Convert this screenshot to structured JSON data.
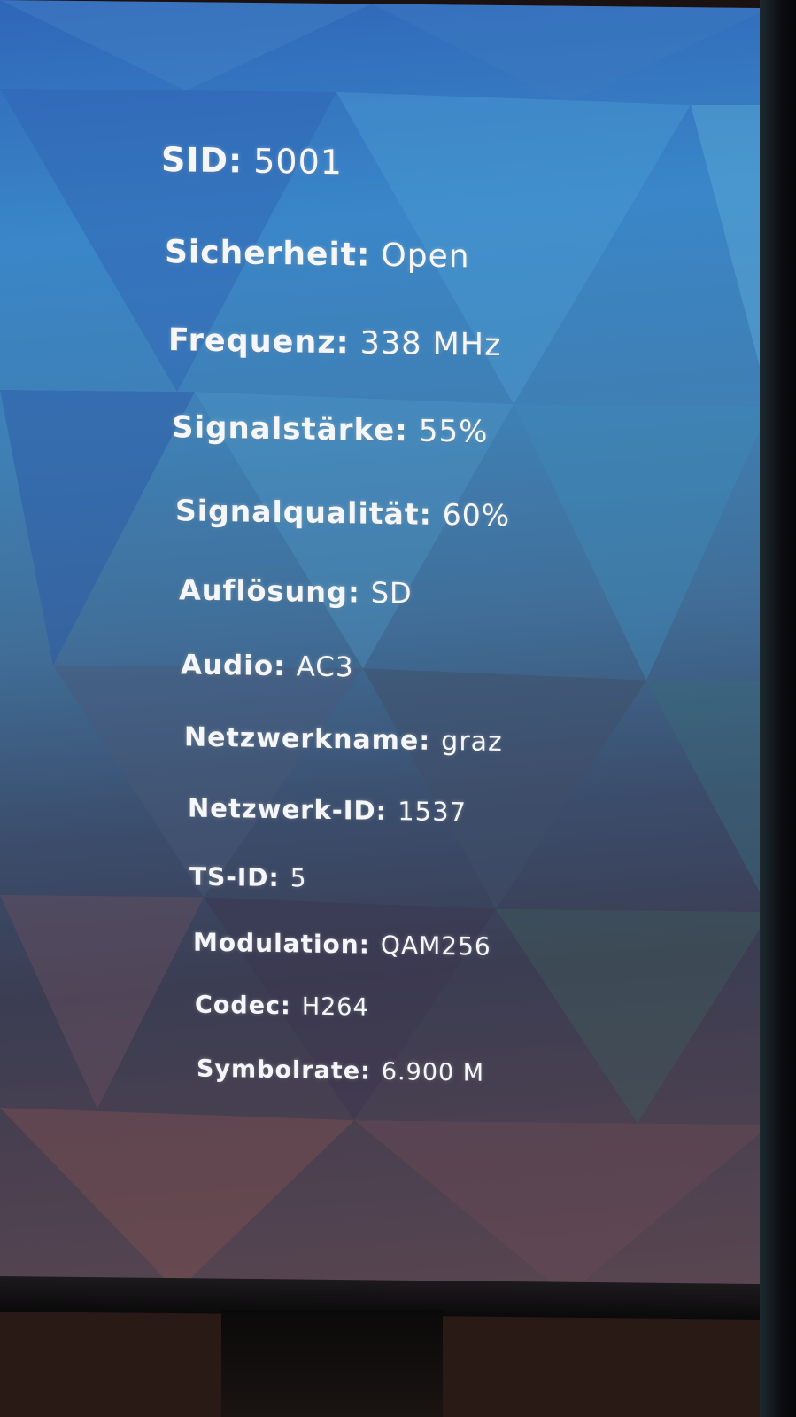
{
  "channel_info": {
    "rows": [
      {
        "label": "SID:",
        "value": "5001"
      },
      {
        "label": "Sicherheit:",
        "value": "Open"
      },
      {
        "label": "Frequenz:",
        "value": "338 MHz"
      },
      {
        "label": "Signalstärke:",
        "value": "55%"
      },
      {
        "label": "Signalqualität:",
        "value": "60%"
      },
      {
        "label": "Auflösung:",
        "value": "SD"
      },
      {
        "label": "Audio:",
        "value": "AC3"
      },
      {
        "label": "Netzwerkname:",
        "value": "graz"
      },
      {
        "label": "Netzwerk-ID:",
        "value": "1537"
      },
      {
        "label": "TS-ID:",
        "value": "5"
      },
      {
        "label": "Modulation:",
        "value": "QAM256"
      },
      {
        "label": "Codec:",
        "value": "H264"
      },
      {
        "label": "Symbolrate:",
        "value": "6.900 M"
      }
    ]
  },
  "colors": {
    "text": "#f4f6fa",
    "background_top": "#2f66b8",
    "background_bottom": "#5a4650"
  }
}
